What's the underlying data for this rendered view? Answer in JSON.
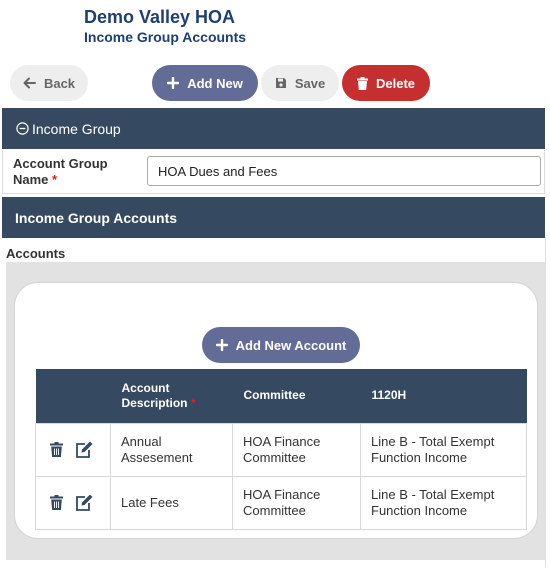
{
  "header": {
    "org_name": "Demo Valley HOA",
    "page_title": "Income Group Accounts"
  },
  "toolbar": {
    "back_label": "Back",
    "add_new_label": "Add New",
    "save_label": "Save",
    "delete_label": "Delete"
  },
  "income_group": {
    "section_title": "Income Group",
    "field_label": "Account Group Name",
    "required_mark": "*",
    "field_value": "HOA Dues and Fees"
  },
  "accounts_section": {
    "section_title": "Income Group Accounts",
    "list_label": "Accounts",
    "add_account_label": "Add New Account",
    "columns": {
      "description": "Account Description",
      "description_required": "*",
      "committee": "Committee",
      "tax": "1120H"
    },
    "rows": [
      {
        "description": "Annual Assesement",
        "committee": "HOA Finance Committee",
        "tax": "Line B - Total Exempt Function Income"
      },
      {
        "description": "Late Fees",
        "committee": "HOA Finance Committee",
        "tax": "Line B - Total Exempt Function Income"
      }
    ]
  },
  "colors": {
    "navy_bar": "#354960",
    "primary_button": "#636c96",
    "danger_button": "#c62f2f",
    "title": "#1f3f73"
  }
}
